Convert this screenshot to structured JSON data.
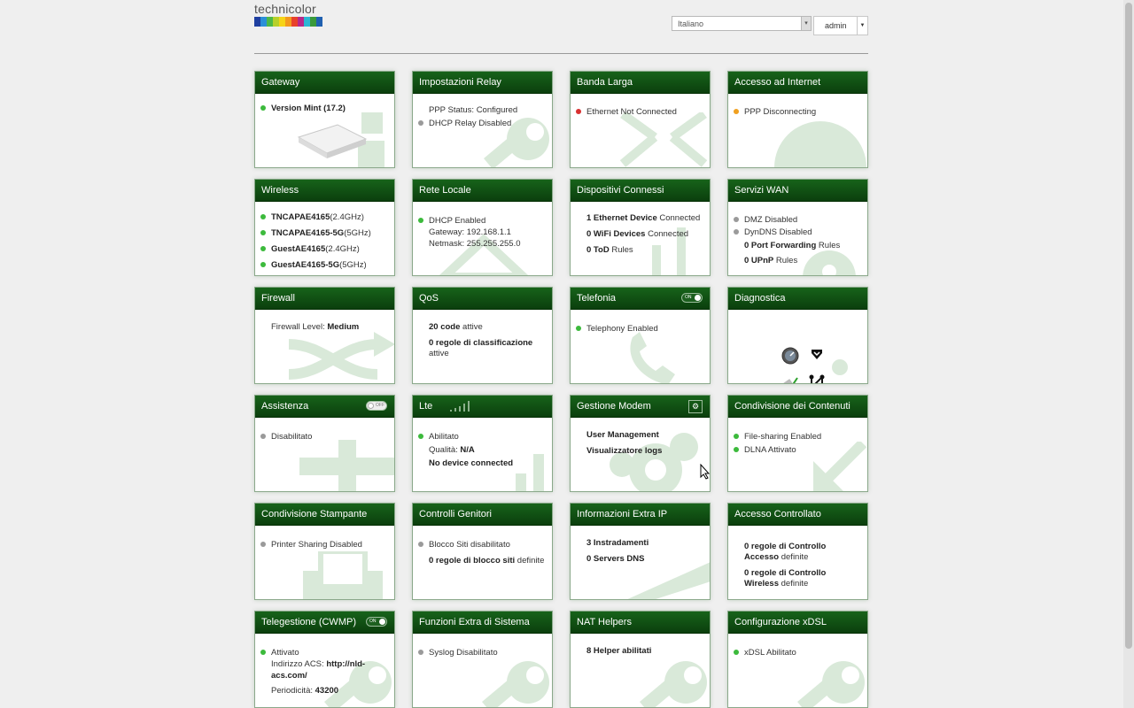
{
  "header": {
    "logo_text": "technicolor",
    "language": "Italiano",
    "user": "admin"
  },
  "colors": {
    "header_green": "#0b3f0d",
    "status_green": "#3cba3c",
    "status_red": "#d83030",
    "status_orange": "#f0a020",
    "status_gray": "#9a9a9a"
  },
  "cards": {
    "gateway": {
      "title": "Gateway",
      "version": "Version Mint (17.2)"
    },
    "relay": {
      "title": "Impostazioni Relay",
      "ppp_status": "PPP Status: Configured",
      "dhcp_relay": "DHCP Relay Disabled"
    },
    "broadband": {
      "title": "Banda Larga",
      "status": "Ethernet Not Connected"
    },
    "internet": {
      "title": "Accesso ad Internet",
      "status": "PPP Disconnecting"
    },
    "wireless": {
      "title": "Wireless",
      "networks": [
        {
          "ssid": "TNCAPAE4165",
          "band": "(2.4GHz)"
        },
        {
          "ssid": "TNCAPAE4165-5G",
          "band": "(5GHz)"
        },
        {
          "ssid": "GuestAE4165",
          "band": "(2.4GHz)"
        },
        {
          "ssid": "GuestAE4165-5G",
          "band": "(5GHz)"
        }
      ]
    },
    "lan": {
      "title": "Rete Locale",
      "dhcp": "DHCP Enabled",
      "gateway": "Gateway: 192.168.1.1",
      "netmask": "Netmask: 255.255.255.0"
    },
    "devices": {
      "title": "Dispositivi Connessi",
      "eth_count": "1 Ethernet Device",
      "eth_suffix": " Connected",
      "wifi_count": "0 WiFi Devices",
      "wifi_suffix": " Connected",
      "tod_count": "0 ToD",
      "tod_suffix": " Rules"
    },
    "wan": {
      "title": "Servizi WAN",
      "dmz": "DMZ Disabled",
      "dyndns": "DynDNS Disabled",
      "pf_count": "0 Port Forwarding",
      "pf_suffix": " Rules",
      "upnp_count": "0 UPnP",
      "upnp_suffix": " Rules"
    },
    "firewall": {
      "title": "Firewall",
      "level_label": "Firewall Level: ",
      "level": "Medium"
    },
    "qos": {
      "title": "QoS",
      "queues": "20 code",
      "queues_suffix": " attive",
      "rules": "0 regole di classificazione",
      "rules_suffix": "attive"
    },
    "telephony": {
      "title": "Telefonia",
      "toggle": "ON",
      "status": "Telephony Enabled"
    },
    "diagnostics": {
      "title": "Diagnostica"
    },
    "assistance": {
      "title": "Assistenza",
      "toggle": "OFF",
      "status": "Disabilitato"
    },
    "lte": {
      "title": "Lte",
      "status": "Abilitato",
      "quality_label": "Qualità: ",
      "quality": "N/A",
      "device": "No device connected"
    },
    "modem": {
      "title": "Gestione Modem",
      "user_mgmt": "User Management",
      "logs": "Visualizzatore logs"
    },
    "content_sharing": {
      "title": "Condivisione dei Contenuti",
      "file_sharing": "File-sharing Enabled",
      "dlna": "DLNA Attivato"
    },
    "printer": {
      "title": "Condivisione Stampante",
      "status": "Printer Sharing Disabled"
    },
    "parental": {
      "title": "Controlli Genitori",
      "blocking": "Blocco Siti disabilitato",
      "rules": "0 regole di blocco siti",
      "rules_suffix": " definite"
    },
    "extra_ip": {
      "title": "Informazioni Extra IP",
      "routes": "3 Instradamenti",
      "dns": "0 Servers DNS"
    },
    "access_control": {
      "title": "Accesso Controllato",
      "access_rules_1": "0 regole di Controllo",
      "access_rules_2": "Accesso",
      "access_suffix": " definite",
      "wireless_rules_1": "0 regole di Controllo",
      "wireless_rules_2": "Wireless",
      "wireless_suffix": " definite"
    },
    "cwmp": {
      "title": "Telegestione (CWMP)",
      "toggle": "ON",
      "status": "Attivato",
      "acs_label": "Indirizzo ACS: ",
      "acs_url_1": "http://nld-",
      "acs_url_2": "acs.com/",
      "period_label": "Periodicità: ",
      "period": "43200"
    },
    "system_extra": {
      "title": "Funzioni Extra di Sistema",
      "syslog": "Syslog Disabilitato"
    },
    "nat": {
      "title": "NAT Helpers",
      "helpers": "8 Helper abilitati"
    },
    "xdsl": {
      "title": "Configurazione xDSL",
      "status": "xDSL Abilitato"
    }
  }
}
